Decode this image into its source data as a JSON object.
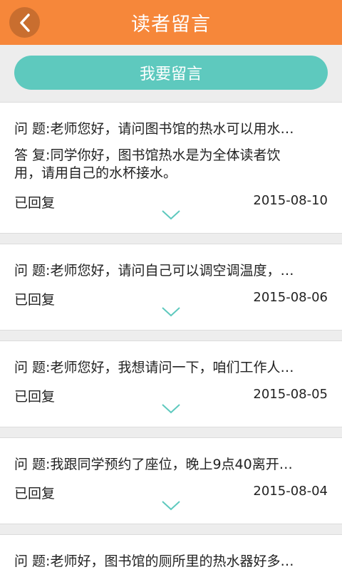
{
  "header": {
    "title": "读者留言",
    "back_icon": "chevron-left-icon"
  },
  "action": {
    "leave_message_label": "我要留言"
  },
  "colors": {
    "header_bg": "#f6873a",
    "button_bg": "#5ec9be",
    "chevron": "#5ec9be"
  },
  "messages": [
    {
      "question": "问 题:老师您好，请问图书馆的热水可以用水…",
      "answer": "答 复:同学你好，图书馆热水是为全体读者饮用，请用自己的水杯接水。",
      "status": "已回复",
      "date": "2015-08-10"
    },
    {
      "question": "问 题:老师您好，请问自己可以调空调温度，…",
      "status": "已回复",
      "date": "2015-08-06"
    },
    {
      "question": "问 题:老师您好，我想请问一下，咱们工作人…",
      "status": "已回复",
      "date": "2015-08-05"
    },
    {
      "question": "问 题:我跟同学预约了座位，晚上9点40离开…",
      "status": "已回复",
      "date": "2015-08-04"
    },
    {
      "question": "问 题:老师好，图书馆的厕所里的热水器好多…"
    }
  ]
}
